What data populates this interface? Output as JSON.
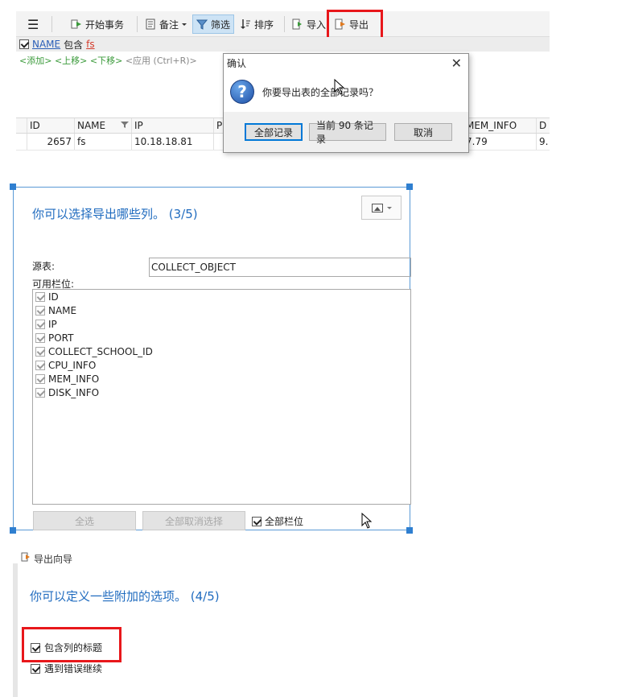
{
  "toolbar": {
    "menu_label": "☰",
    "begin_tx": "开始事务",
    "note": "备注",
    "filter": "筛选",
    "sort": "排序",
    "import": "导入",
    "export": "导出"
  },
  "filter_bar": {
    "field": "NAME",
    "op": "包含",
    "value": "fs"
  },
  "filter_actions": {
    "add": "<添加>",
    "up": "<上移>",
    "down": "<下移>",
    "apply": "<应用 (Ctrl+R)>"
  },
  "grid": {
    "columns": [
      "ID",
      "NAME",
      "IP",
      "P",
      "MEM_INFO",
      "D"
    ],
    "rows": [
      [
        "2657",
        "fs",
        "10.18.18.81",
        "",
        "7.79",
        "9."
      ]
    ]
  },
  "confirm_dialog": {
    "title": "确认",
    "message": "你要导出表的全部记录吗？",
    "buttons": [
      "全部记录",
      "当前 90 条记录",
      "取消"
    ]
  },
  "wizard3": {
    "title": "你可以选择导出哪些列。 (3/5)",
    "source_label": "源表:",
    "source_value": "COLLECT_OBJECT",
    "available_label": "可用栏位:",
    "columns": [
      "ID",
      "NAME",
      "IP",
      "PORT",
      "COLLECT_SCHOOL_ID",
      "CPU_INFO",
      "MEM_INFO",
      "DISK_INFO"
    ],
    "select_all": "全选",
    "deselect_all": "全部取消选择",
    "all_fields": "全部栏位"
  },
  "wizard4": {
    "header": "导出向导",
    "title": "你可以定义一些附加的选项。 (4/5)",
    "opt_header": "包含列的标题",
    "opt_continue": "遇到错误继续"
  },
  "colors": {
    "accent_blue": "#1f6bbf",
    "highlight_red": "#e8171b",
    "selection_blue": "#2f7fd0"
  }
}
